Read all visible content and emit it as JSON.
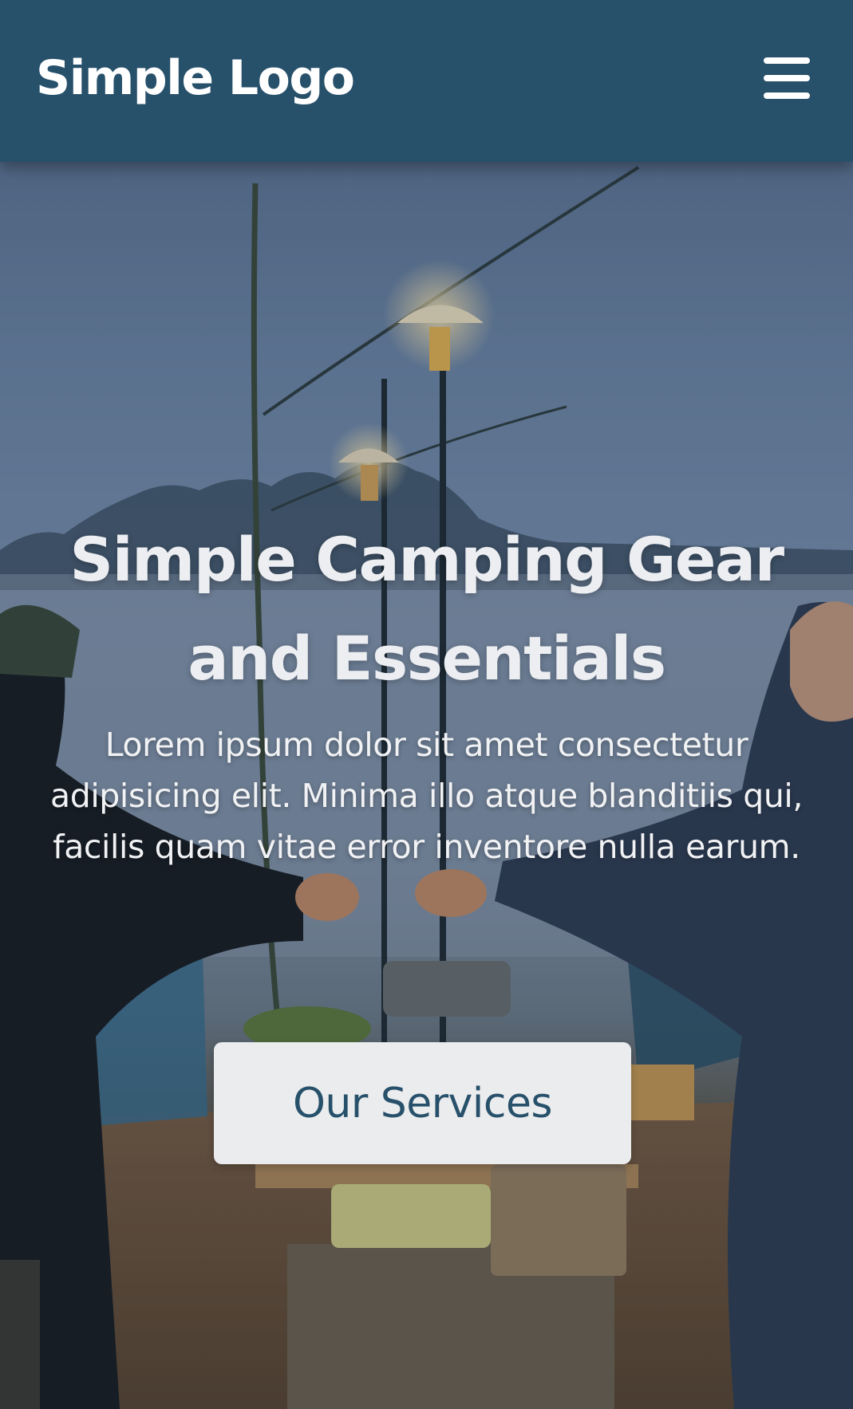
{
  "header": {
    "logo_text": "Simple Logo",
    "menu_icon": "hamburger-menu-icon",
    "background_color": "#27506a"
  },
  "hero": {
    "background_image": "camping-scene-photo",
    "title": "Simple Camping Gear and Essentials",
    "description": "Lorem ipsum dolor sit amet consectetur adipisicing elit. Minima illo atque blanditiis qui, facilis quam vitae error inventore nulla earum.",
    "cta_label": "Our Services",
    "cta_background_color": "#ebecee",
    "cta_text_color": "#27506a"
  }
}
